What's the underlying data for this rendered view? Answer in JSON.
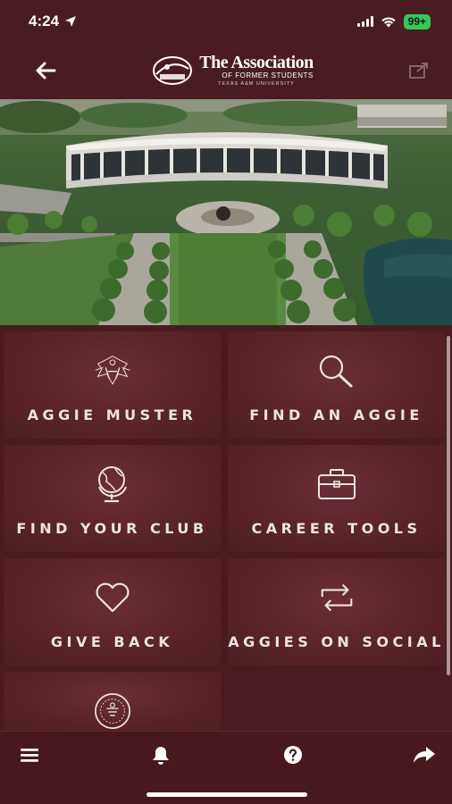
{
  "status_bar": {
    "time": "4:24",
    "battery": "99+"
  },
  "header": {
    "brand_title": "The Association",
    "brand_subtitle": "OF FORMER STUDENTS",
    "brand_tagline": "TEXAS A&M UNIVERSITY",
    "back_icon": "arrow-left-icon",
    "external_icon": "external-link-icon"
  },
  "tiles": [
    {
      "label": "AGGIE MUSTER",
      "icon": "muster-crest-icon"
    },
    {
      "label": "FIND AN AGGIE",
      "icon": "search-icon"
    },
    {
      "label": "FIND YOUR CLUB",
      "icon": "globe-icon"
    },
    {
      "label": "CAREER TOOLS",
      "icon": "briefcase-icon"
    },
    {
      "label": "GIVE BACK",
      "icon": "heart-icon"
    },
    {
      "label": "AGGIES ON SOCIAL",
      "icon": "retweet-icon"
    }
  ],
  "bottom_nav": {
    "items": [
      "menu-icon",
      "bell-icon",
      "help-icon",
      "share-icon"
    ]
  },
  "colors": {
    "background": "#4a1c21",
    "tile": "#5a2429",
    "battery": "#34c759"
  }
}
